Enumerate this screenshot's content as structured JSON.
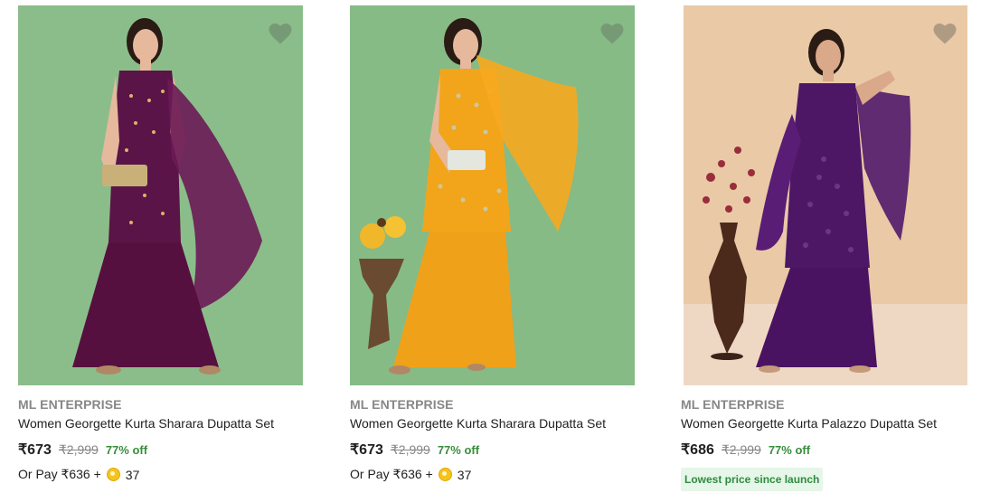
{
  "products": [
    {
      "brand": "ML ENTERPRISE",
      "title": "Women Georgette Kurta Sharara Dupatta Set",
      "price": "₹673",
      "mrp": "₹2,999",
      "discount": "77% off",
      "pay_prefix": "Or Pay ₹636 +",
      "coins": "37",
      "image_bg": "#8bbd8a",
      "outfit_color": "#5b1447",
      "wishlist_icon": "heart-icon"
    },
    {
      "brand": "ML ENTERPRISE",
      "title": "Women Georgette Kurta Sharara Dupatta Set",
      "price": "₹673",
      "mrp": "₹2,999",
      "discount": "77% off",
      "pay_prefix": "Or Pay ₹636 +",
      "coins": "37",
      "image_bg": "#86bb86",
      "outfit_color": "#f2a51a",
      "wishlist_icon": "heart-icon"
    },
    {
      "brand": "ML ENTERPRISE",
      "title": "Women Georgette Kurta Palazzo Dupatta Set",
      "price": "₹686",
      "mrp": "₹2,999",
      "discount": "77% off",
      "badge": "Lowest price since launch",
      "image_bg": "#e9c9a6",
      "outfit_color": "#4d1766",
      "wishlist_icon": "heart-icon"
    }
  ]
}
